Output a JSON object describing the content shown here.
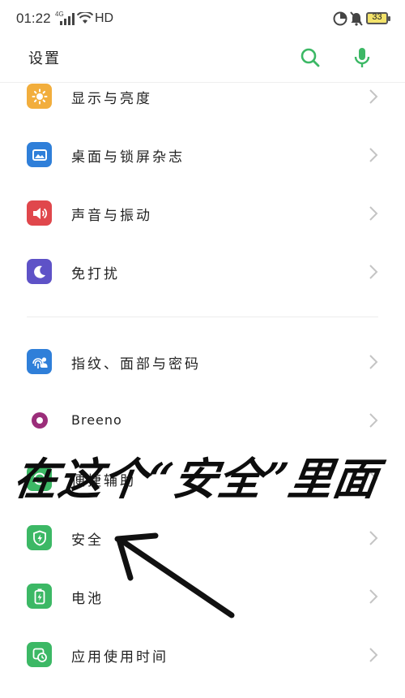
{
  "status_bar": {
    "time": "01:22",
    "network_label": "4G",
    "hd_label": "HD",
    "battery_level": "33"
  },
  "header": {
    "title": "设置"
  },
  "settings": {
    "items": [
      {
        "label": "显示与亮度",
        "icon": "brightness-icon",
        "color": "#F2AE3D"
      },
      {
        "label": "桌面与锁屏杂志",
        "icon": "wallpaper-icon",
        "color": "#2F7FD9"
      },
      {
        "label": "声音与振动",
        "icon": "speaker-icon",
        "color": "#E0474C"
      },
      {
        "label": "免打扰",
        "icon": "moon-icon",
        "color": "#5E52C7"
      },
      {
        "label": "指纹、面部与密码",
        "icon": "fingerprint-icon",
        "color": "#2F7FD9"
      },
      {
        "label": "Breeno",
        "icon": "breeno-icon",
        "color": "#9B2D7A"
      },
      {
        "label": "便捷辅助",
        "icon": "assist-icon",
        "color": "#3CB865"
      },
      {
        "label": "安全",
        "icon": "shield-icon",
        "color": "#3CB865"
      },
      {
        "label": "电池",
        "icon": "battery-icon",
        "color": "#3CB865"
      },
      {
        "label": "应用使用时间",
        "icon": "app-time-icon",
        "color": "#3CB865"
      }
    ]
  },
  "overlay": {
    "annotation": "在这个“安全”里面"
  },
  "colors": {
    "accent": "#3CB865"
  }
}
